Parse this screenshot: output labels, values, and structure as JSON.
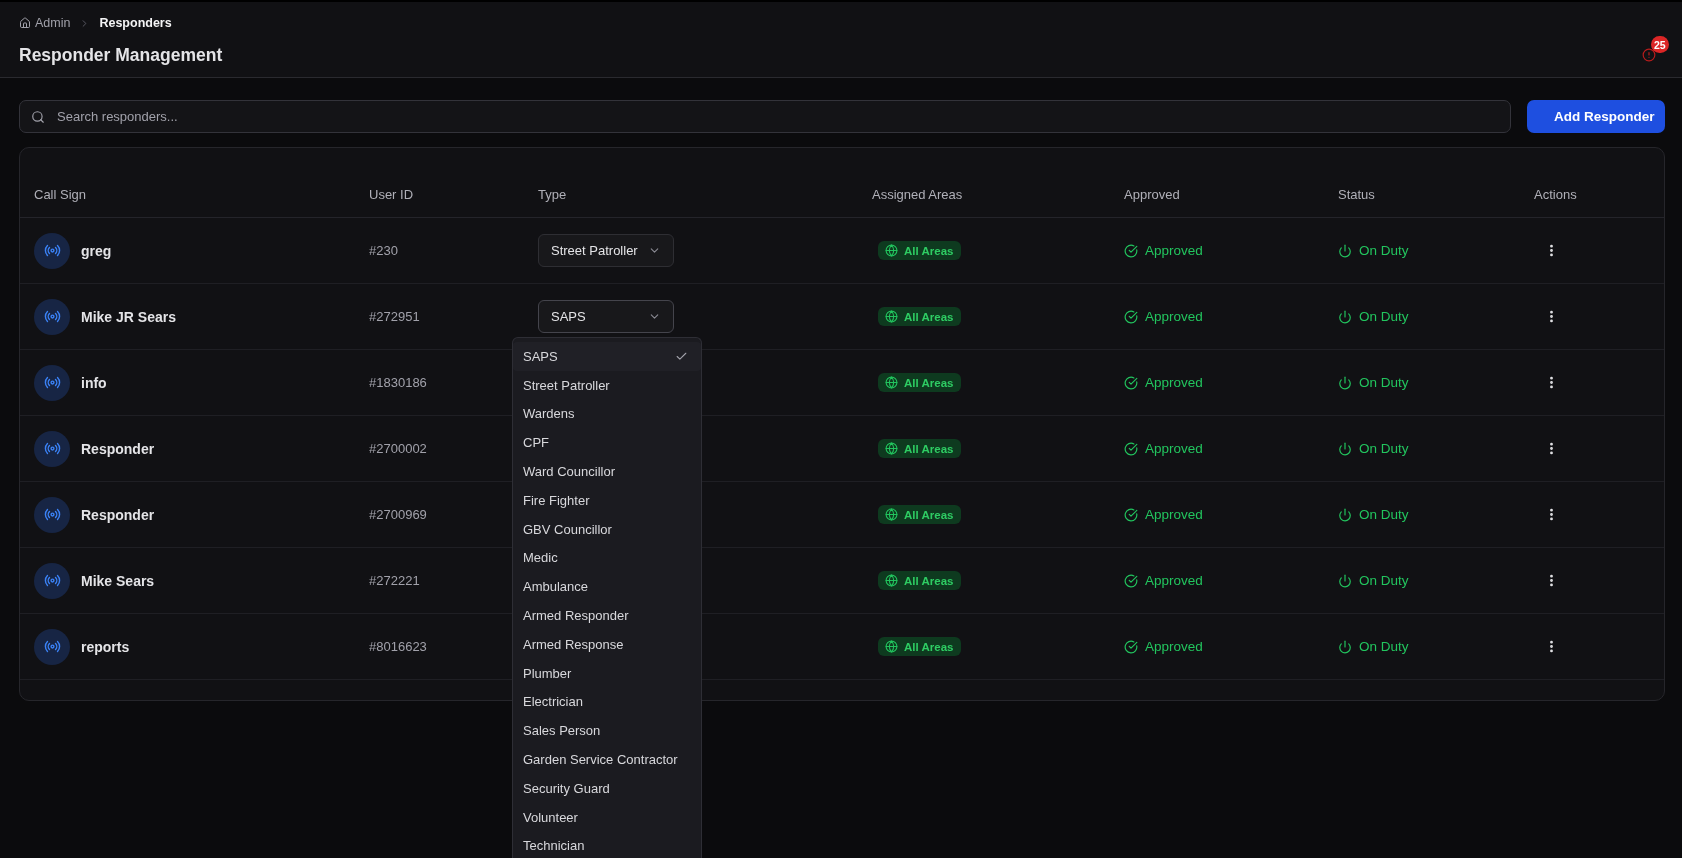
{
  "breadcrumb": [
    {
      "label": "Admin",
      "current": false
    },
    {
      "label": "Responders",
      "current": true
    }
  ],
  "header": {
    "title": "Responder Management",
    "alert_count": "25"
  },
  "search": {
    "placeholder": "Search responders..."
  },
  "add_button": {
    "label": "Add Responder"
  },
  "table": {
    "columns": [
      "Call Sign",
      "User ID",
      "Type",
      "Assigned Areas",
      "Approved",
      "Status",
      "Actions"
    ],
    "rows": [
      {
        "call_sign": "greg",
        "user_id": "#230",
        "type": {
          "value": "Street Patroller",
          "expanded": false
        },
        "areas": "All Areas",
        "approved": "Approved",
        "status": "On Duty"
      },
      {
        "call_sign": "Mike JR Sears",
        "user_id": "#272951",
        "type": {
          "value": "SAPS",
          "expanded": true
        },
        "areas": "All Areas",
        "approved": "Approved",
        "status": "On Duty"
      },
      {
        "call_sign": "info",
        "user_id": "#1830186",
        "areas": "All Areas",
        "approved": "Approved",
        "status": "On Duty"
      },
      {
        "call_sign": "Responder",
        "user_id": "#2700002",
        "areas": "All Areas",
        "approved": "Approved",
        "status": "On Duty"
      },
      {
        "call_sign": "Responder",
        "user_id": "#2700969",
        "areas": "All Areas",
        "approved": "Approved",
        "status": "On Duty"
      },
      {
        "call_sign": "Mike Sears",
        "user_id": "#272221",
        "areas": "All Areas",
        "approved": "Approved",
        "status": "On Duty"
      },
      {
        "call_sign": "reports",
        "user_id": "#8016623",
        "areas": "All Areas",
        "approved": "Approved",
        "status": "On Duty"
      }
    ],
    "type_options": [
      {
        "label": "SAPS",
        "selected": true
      },
      {
        "label": "Street Patroller",
        "selected": false
      },
      {
        "label": "Wardens",
        "selected": false
      },
      {
        "label": "CPF",
        "selected": false
      },
      {
        "label": "Ward Councillor",
        "selected": false
      },
      {
        "label": "Fire Fighter",
        "selected": false
      },
      {
        "label": "GBV Councillor",
        "selected": false
      },
      {
        "label": "Medic",
        "selected": false
      },
      {
        "label": "Ambulance",
        "selected": false
      },
      {
        "label": "Armed Responder",
        "selected": false
      },
      {
        "label": "Armed Response",
        "selected": false
      },
      {
        "label": "Plumber",
        "selected": false
      },
      {
        "label": "Electrician",
        "selected": false
      },
      {
        "label": "Sales Person",
        "selected": false
      },
      {
        "label": "Garden Service Contractor",
        "selected": false
      },
      {
        "label": "Security Guard",
        "selected": false
      },
      {
        "label": "Volunteer",
        "selected": false
      },
      {
        "label": "Technician",
        "selected": false
      }
    ]
  }
}
